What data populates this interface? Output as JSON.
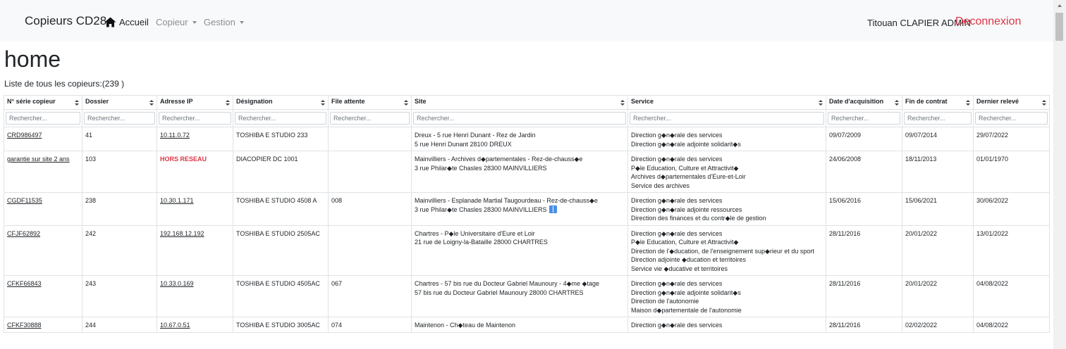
{
  "nav": {
    "brand": "Copieurs CD28",
    "home_label": "Accueil",
    "copieur_label": "Copieur",
    "gestion_label": "Gestion",
    "user_name": "Titouan CLAPIER ADMIN",
    "logout_label": "Deconnexion",
    "home_icon": "home-icon",
    "logout_color": "#dc3545"
  },
  "page": {
    "title": "home",
    "subtitle": "Liste de tous les copieurs:(239 )"
  },
  "table": {
    "columns": [
      "N° série copieur",
      "Dossier",
      "Adresse IP",
      "Désignation",
      "File attente",
      "Site",
      "Service",
      "Date d'acquisition",
      "Fin de contrat",
      "Dernier relevé"
    ],
    "filter_placeholder": "Rechercher...",
    "rows": [
      {
        "serie": "CRD986497",
        "dossier": "41",
        "ip": "10.11.0.72",
        "designation": "TOSHIBA E STUDIO 233",
        "file_attente": "",
        "site_line1": "Dreux - 5 rue Henri Dunant - Rez de Jardin",
        "site_line2": "5 rue Henri Dunant 28100 DREUX",
        "services": [
          "Direction g◆n◆rale des services",
          "Direction g◆n◆rale adjointe solidarit◆s"
        ],
        "date_acquisition": "09/07/2009",
        "fin_contrat": "09/07/2014",
        "dernier_releve": "29/07/2022"
      },
      {
        "serie": "garantie sur site 2 ans",
        "dossier": "103",
        "ip": "HORS RESEAU",
        "designation": "DIACOPIER DC 1001",
        "file_attente": "",
        "site_line1": "Mainvilliers - Archives d◆partementales - Rez-de-chauss◆e",
        "site_line2": "3 rue Philar◆te Chasles 28300 MAINVILLIERS",
        "services": [
          "Direction g◆n◆rale des services",
          "P◆le Education, Culture et Attractivit◆",
          "Archives d◆partementales d'Eure-et-Loir",
          "Service des archives"
        ],
        "date_acquisition": "24/06/2008",
        "fin_contrat": "18/11/2013",
        "dernier_releve": "01/01/1970"
      },
      {
        "serie": "CGDF11535",
        "dossier": "238",
        "ip": "10.30.1.171",
        "designation": "TOSHIBA E STUDIO 4508 A",
        "file_attente": "008",
        "site_line1": "Mainvilliers - Esplanade Martial Taugourdeau - Rez-de-chauss◆e",
        "site_line2": "3 rue Philar◆te Chasles 28300 MAINVILLIERS",
        "services": [
          "Direction g◆n◆rale des services",
          "Direction g◆n◆rale adjointe ressources",
          "Direction des finances et du contr◆le de gestion"
        ],
        "date_acquisition": "15/06/2016",
        "fin_contrat": "15/06/2021",
        "dernier_releve": "30/06/2022"
      },
      {
        "serie": "CFJF62892",
        "dossier": "242",
        "ip": "192.168.12.192",
        "designation": "TOSHIBA E STUDIO 2505AC",
        "file_attente": "",
        "site_line1": "Chartres - P◆le Universitaire d'Eure et Loir",
        "site_line2": "21 rue de Loigny-la-Bataille 28000 CHARTRES",
        "services": [
          "Direction g◆n◆rale des services",
          "P◆le Education, Culture et Attractivit◆",
          "Direction de l'◆ducation, de l'enseignement sup◆rieur et du sport",
          "Direction adjointe ◆ducation et territoires",
          "Service vie ◆ducative et territoires"
        ],
        "date_acquisition": "28/11/2016",
        "fin_contrat": "20/01/2022",
        "dernier_releve": "13/01/2022"
      },
      {
        "serie": "CFKF66843",
        "dossier": "243",
        "ip": "10.33.0.169",
        "designation": "TOSHIBA E STUDIO 4505AC",
        "file_attente": "067",
        "site_line1": "Chartres - 57 bis rue du Docteur Gabriel Maunoury - 4◆me ◆tage",
        "site_line2": "57 bis rue du Docteur Gabriel Maunoury 28000 CHARTRES",
        "services": [
          "Direction g◆n◆rale des services",
          "Direction g◆n◆rale adjointe solidarit◆s",
          "Direction de l'autonomie",
          "Maison d◆partementale de l'autonomie"
        ],
        "date_acquisition": "28/11/2016",
        "fin_contrat": "20/01/2022",
        "dernier_releve": "04/08/2022"
      },
      {
        "serie": "CFKF30888",
        "dossier": "244",
        "ip": "10.67.0.51",
        "designation": "TOSHIBA E STUDIO 3005AC",
        "file_attente": "074",
        "site_line1": "Maintenon - Ch◆teau de Maintenon",
        "site_line2": "",
        "services": [
          "Direction g◆n◆rale des services"
        ],
        "date_acquisition": "28/11/2016",
        "fin_contrat": "02/02/2022",
        "dernier_releve": "04/08/2022"
      }
    ]
  }
}
